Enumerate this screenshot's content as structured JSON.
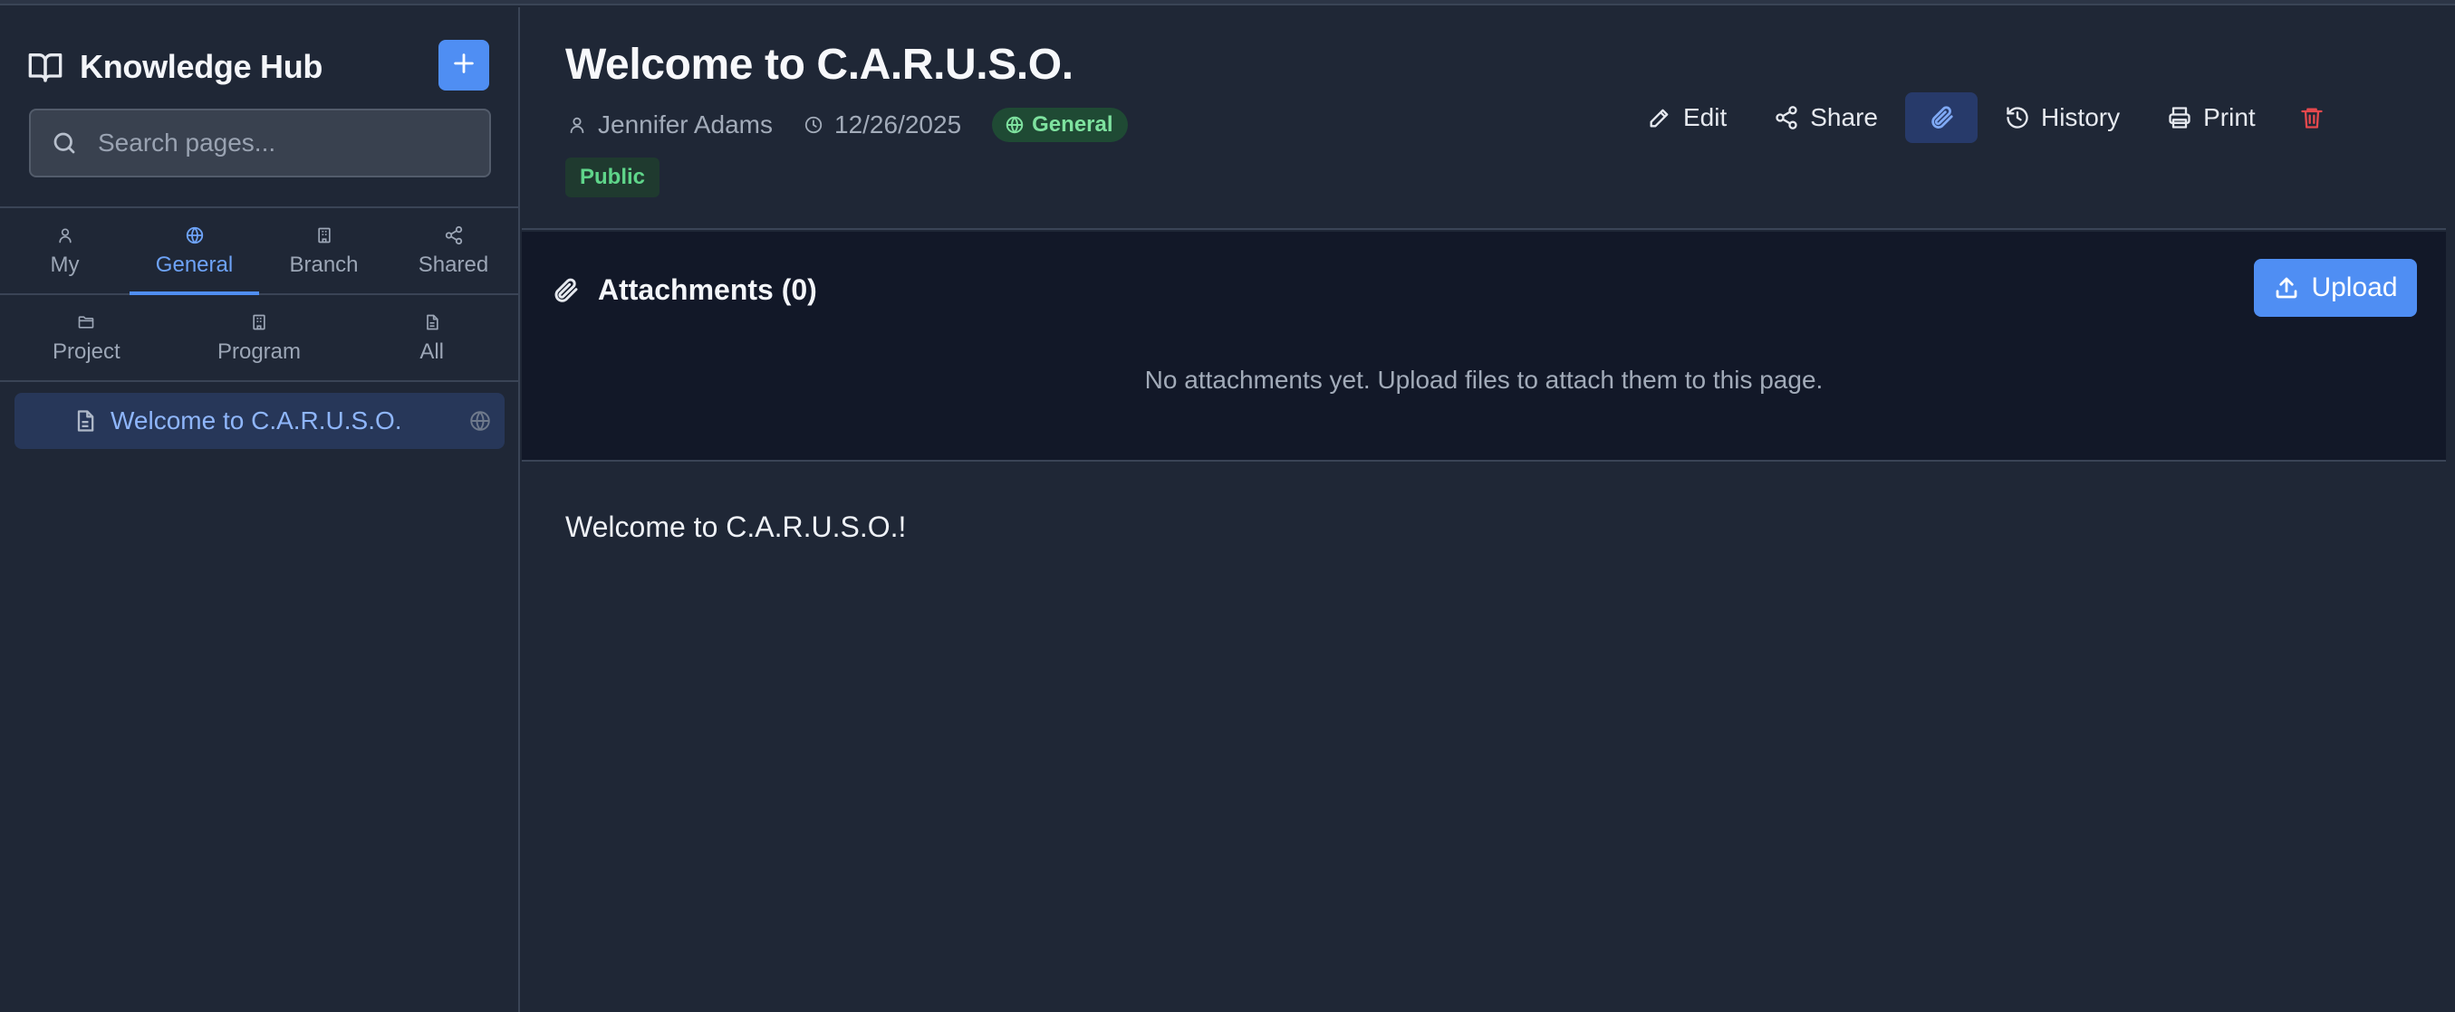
{
  "sidebar": {
    "title": "Knowledge Hub",
    "new_page_label": "+",
    "search": {
      "placeholder": "Search pages..."
    },
    "tabs_primary": [
      {
        "label": "My",
        "icon": "user-icon"
      },
      {
        "label": "General",
        "icon": "globe-icon",
        "active": true
      },
      {
        "label": "Branch",
        "icon": "building-icon"
      },
      {
        "label": "Shared",
        "icon": "share-icon"
      }
    ],
    "tabs_secondary": [
      {
        "label": "Project",
        "icon": "folder-icon"
      },
      {
        "label": "Program",
        "icon": "building-icon"
      },
      {
        "label": "All",
        "icon": "document-icon"
      }
    ],
    "pages": [
      {
        "label": "Welcome to C.A.R.U.S.O.",
        "selected": true
      }
    ]
  },
  "page": {
    "title": "Welcome to C.A.R.U.S.O.",
    "author": "Jennifer Adams",
    "date": "12/26/2025",
    "category_badge": "General",
    "visibility_badge": "Public",
    "content": "Welcome to C.A.R.U.S.O.!"
  },
  "actions": {
    "edit": "Edit",
    "share": "Share",
    "history": "History",
    "print": "Print"
  },
  "attachments": {
    "title": "Attachments (0)",
    "upload_label": "Upload",
    "empty_message": "No attachments yet. Upload files to attach them to this page."
  },
  "colors": {
    "accent": "#4f8ef3",
    "background": "#1f2736",
    "attachments_bg": "#121828",
    "success": "#5fd58a",
    "danger": "#e5484d"
  }
}
